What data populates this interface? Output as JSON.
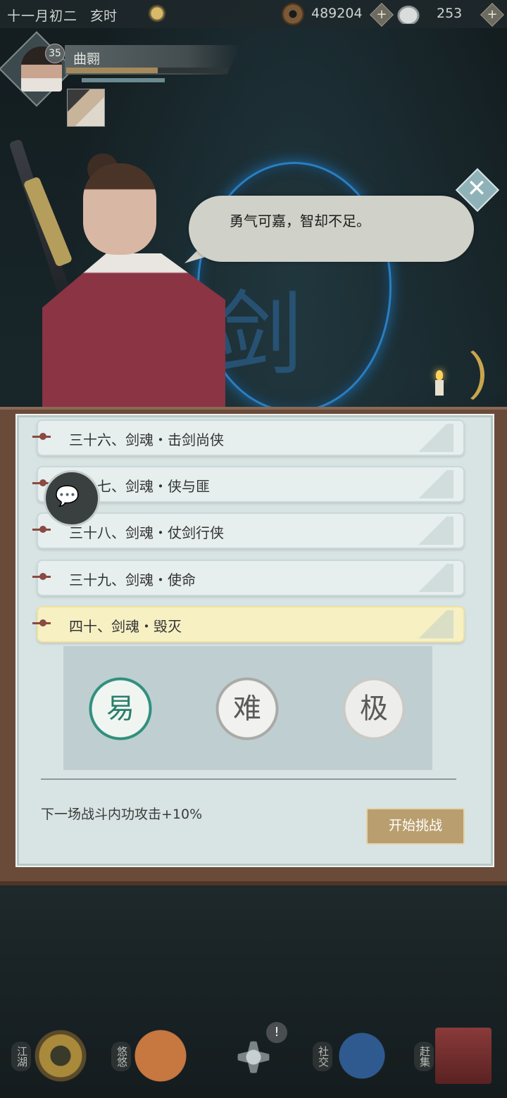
{
  "top_bar": {
    "date": "十一月初二",
    "hour": "亥时",
    "copper": "489204",
    "silver": "253",
    "plus_symbol": "+"
  },
  "player": {
    "level": "35",
    "name": "曲翾"
  },
  "dialog": {
    "text": "勇气可嘉，智却不足。",
    "close_symbol": "✕"
  },
  "background_glyph": "剑",
  "stages": [
    {
      "label": "三十六、剑魂・击剑尚侠",
      "active": false
    },
    {
      "label": "三十七、剑魂・侠与匪",
      "active": false
    },
    {
      "label": "三十八、剑魂・仗剑行侠",
      "active": false
    },
    {
      "label": "三十九、剑魂・使命",
      "active": false
    },
    {
      "label": "四十、剑魂・毁灭",
      "active": true
    }
  ],
  "difficulty": {
    "easy": "易",
    "hard": "难",
    "extreme": "极"
  },
  "buff_text": "下一场战斗内功攻击+10%",
  "start_button": "开始挑战",
  "chat_icon": "💬",
  "bottom_nav": {
    "jianghu": "江湖",
    "youyou": "悠悠",
    "badge": "!",
    "shejiao": "社交",
    "ganji": "赶集"
  },
  "colors": {
    "accent_gold": "#b99e6f",
    "active_stage": "#f6f0c3",
    "glow_blue": "#2a7fc0"
  }
}
